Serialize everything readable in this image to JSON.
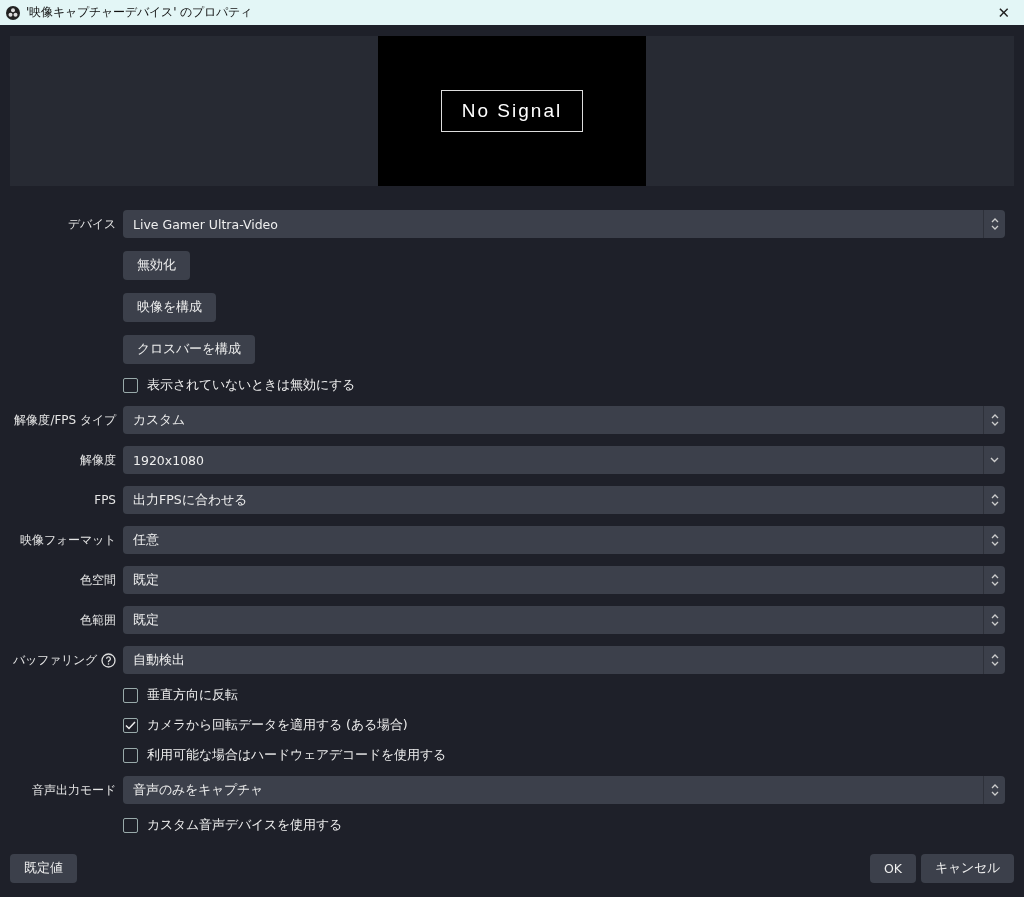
{
  "window": {
    "title": "'映像キャプチャーデバイス' のプロパティ",
    "close": "✕"
  },
  "preview": {
    "message": "No Signal"
  },
  "rows": [
    {
      "kind": "select",
      "label": "デバイス",
      "value": "Live Gamer Ultra-Video"
    },
    {
      "kind": "button",
      "label": "無効化"
    },
    {
      "kind": "button",
      "label": "映像を構成"
    },
    {
      "kind": "button",
      "label": "クロスバーを構成"
    },
    {
      "kind": "checkbox",
      "label": "表示されていないときは無効にする",
      "checked": false
    },
    {
      "kind": "select",
      "label": "解像度/FPS タイプ",
      "value": "カスタム"
    },
    {
      "kind": "editable",
      "label": "解像度",
      "value": "1920x1080"
    },
    {
      "kind": "select",
      "label": "FPS",
      "value": "出力FPSに合わせる"
    },
    {
      "kind": "select",
      "label": "映像フォーマット",
      "value": "任意"
    },
    {
      "kind": "select",
      "label": "色空間",
      "value": "既定"
    },
    {
      "kind": "select",
      "label": "色範囲",
      "value": "既定"
    },
    {
      "kind": "select",
      "label": "バッファリング",
      "value": "自動検出",
      "help": true
    },
    {
      "kind": "checkbox",
      "label": "垂直方向に反転",
      "checked": false
    },
    {
      "kind": "checkbox",
      "label": "カメラから回転データを適用する (ある場合)",
      "checked": true
    },
    {
      "kind": "checkbox",
      "label": "利用可能な場合はハードウェアデコードを使用する",
      "checked": false
    },
    {
      "kind": "select",
      "label": "音声出力モード",
      "value": "音声のみをキャプチャ"
    },
    {
      "kind": "checkbox",
      "label": "カスタム音声デバイスを使用する",
      "checked": false
    }
  ],
  "footer": {
    "defaults": "既定値",
    "ok": "OK",
    "cancel": "キャンセル"
  }
}
